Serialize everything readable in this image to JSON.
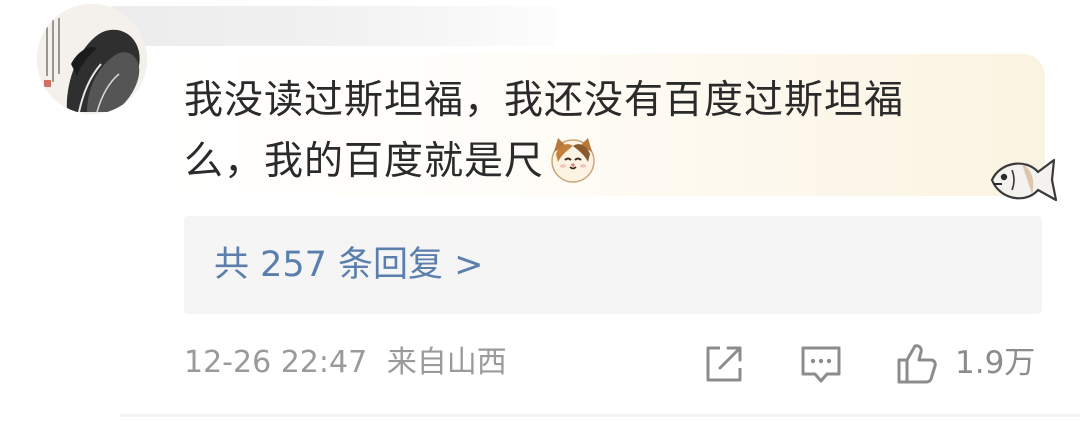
{
  "comment": {
    "text_line1": "我没读过斯坦福，我还没有百度过斯坦福",
    "text_line2": "么，我的百度就是尺",
    "emoji_name": "cat-emoji"
  },
  "replies": {
    "label": "共 257 条回复 >"
  },
  "meta": {
    "timestamp": "12-26 22:47",
    "location": "来自山西"
  },
  "actions": {
    "share_icon": "share-icon",
    "comment_icon": "comment-icon",
    "like_icon": "thumbs-up-icon",
    "like_count": "1.9万"
  },
  "colors": {
    "link": "#5b7fad",
    "meta": "#9a9a9a",
    "reply_bg": "#f5f5f5"
  }
}
